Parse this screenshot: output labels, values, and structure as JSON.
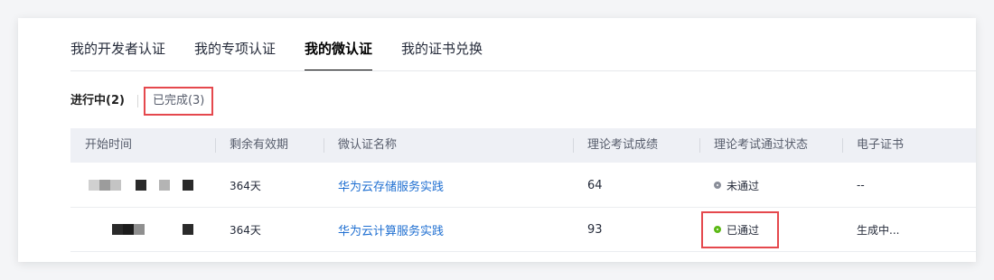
{
  "tabs": [
    {
      "label": "我的开发者认证",
      "active": false
    },
    {
      "label": "我的专项认证",
      "active": false
    },
    {
      "label": "我的微认证",
      "active": true
    },
    {
      "label": "我的证书兑换",
      "active": false
    }
  ],
  "subtabs": {
    "in_progress": "进行中(2)",
    "completed": "已完成(3)"
  },
  "table": {
    "columns": [
      "开始时间",
      "剩余有效期",
      "微认证名称",
      "理论考试成绩",
      "理论考试通过状态",
      "电子证书"
    ],
    "rows": [
      {
        "validity": "364天",
        "name": "华为云存储服务实践",
        "score": "64",
        "status": "未通过",
        "certificate": "--"
      },
      {
        "validity": "364天",
        "name": "华为云计算服务实践",
        "score": "93",
        "status": "已通过",
        "certificate": "生成中..."
      }
    ]
  },
  "colors": {
    "link": "#1f6fd1",
    "highlight": "#e5484d",
    "status_fail": "#8a8e99",
    "status_pass": "#5cb916"
  },
  "icons": {
    "fail": "status-dot-grey-icon",
    "pass": "status-dot-green-icon"
  }
}
